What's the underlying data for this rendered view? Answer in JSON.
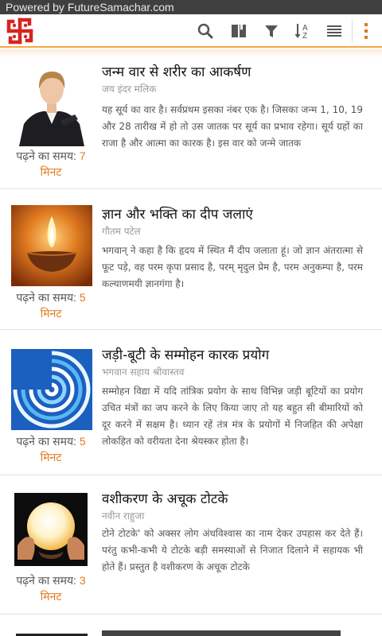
{
  "status_bar": {
    "text": "Powered by FutureSamachar.com"
  },
  "toolbar": {
    "logo": "swastik-logo-icon",
    "icons": [
      "search-icon",
      "book-icon",
      "filter-icon",
      "sort-az-icon",
      "list-view-icon",
      "overflow-menu-icon"
    ],
    "sort_letters": {
      "top": "A",
      "bottom": "Z"
    }
  },
  "colors": {
    "accent": "#e07a1f",
    "logo_red": "#d8241f",
    "toolbar_border": "#f5a74a",
    "statusbar": "#3f3f3f"
  },
  "articles": [
    {
      "title": "जन्म वार से शरीर का आकर्षण",
      "author": "जय इंदर मलिक",
      "excerpt": "यह सूर्य का वार है। सर्वप्रथम इसका नंबर एक है। जिसका जन्म 1, 10, 19 और 28 तारीख में हो तो उस जातक पर सूर्य का प्रभाव रहेगा। सूर्य ग्रहों का राजा है और आत्मा का कारक है। इस वार को जन्मे जातक",
      "read_time_label": "पढ़ने का समय:",
      "read_time_value": "7",
      "read_time_unit": "मिनट",
      "thumb": "businesswoman-photo"
    },
    {
      "title": "ज्ञान और भक्ति का दीप जलाएं",
      "author": "गौतम पटेल",
      "excerpt": "भगवान् ने कहा है कि हृदय में स्थित मैं दीप जलाता हूं। जो ज्ञान अंतरात्मा से फूट पड़े, वह परम कृपा प्रसाद है, परम् मृदुल प्रेम है, परम अनुकम्पा है, परम कल्याणमयी ज्ञानगंगा है।",
      "read_time_label": "पढ़ने का समय:",
      "read_time_value": "5",
      "read_time_unit": "मिनट",
      "thumb": "diya-lamp-photo"
    },
    {
      "title": "जड़ी-बूटी के सम्मोहन कारक प्रयोग",
      "author": "भगवान सहाय श्रीवास्तव",
      "excerpt": "सम्मोहन विद्या में यदि तांत्रिक प्रयोग के साथ विभिन्न जड़ी बूटियों का प्रयोग उचित मंत्रों का जप करने के लिए किया जाए तो यह बहुत सी बीमारियों को दूर करने में सक्षम है। ध्यान रहें तंत्र मंत्र के प्रयोगों में निजहित की अपेक्षा लोकहित को वरीयता देना श्रेयस्कर होता है।",
      "read_time_label": "पढ़ने का समय:",
      "read_time_value": "5",
      "read_time_unit": "मिनट",
      "thumb": "hypnotic-swirl-image"
    },
    {
      "title": "वशीकरण के अचूक टोटके",
      "author": "नवीन राहुजा",
      "excerpt": "टोने टोटके' को अक्सर लोग अंधविश्वास का नाम देकर उपहास कर देते हैं। परंतु कभी-कभी ये टोटके बड़ी समस्याओं से निजात दिलाने में सहायक भी होते हैं। प्रस्तुत है वशीकरण के अचूक टोटके",
      "read_time_label": "पढ़ने का समय:",
      "read_time_value": "3",
      "read_time_unit": "मिनट",
      "thumb": "crystal-ball-photo"
    }
  ]
}
